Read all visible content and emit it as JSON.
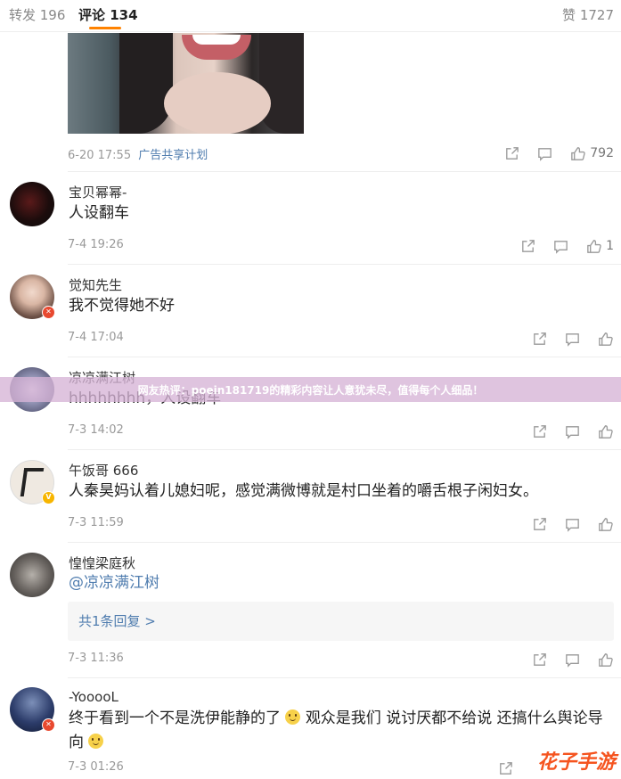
{
  "tabs": {
    "repost": "转发 196",
    "comment": "评论 134",
    "like": "赞 1727"
  },
  "top_post": {
    "time": "6-20 17:55",
    "ad_label": "广告共享计划",
    "like_count": "792"
  },
  "comments": [
    {
      "user": "宝贝幂幂-",
      "text": "人设翻车",
      "time": "7-4 19:26",
      "like_count": "1"
    },
    {
      "user": "觉知先生",
      "text": "我不觉得她不好",
      "time": "7-4 17:04",
      "like_count": ""
    },
    {
      "user": "凉凉满江树",
      "text": "hhhhhhhh，人设翻车",
      "time": "7-3 14:02",
      "like_count": ""
    },
    {
      "user": "午饭哥 666",
      "text": "人秦昊妈认着儿媳妇呢，感觉满微博就是村口坐着的嚼舌根子闲妇女。",
      "time": "7-3 11:59",
      "like_count": ""
    },
    {
      "user": "惶惶梁庭秋",
      "text": "@凉凉满江树",
      "time": "7-3 11:36",
      "like_count": "",
      "replies": "共1条回复 >"
    },
    {
      "user": "-YooooL",
      "text": "终于看到一个不是洗伊能静的了",
      "text_cont": "观众是我们 说讨厌都不给说 还搞什么舆论导向",
      "time": "7-3 01:26",
      "like_count": ""
    }
  ],
  "avatar_badges": {
    "red": "✕",
    "gold": "V"
  },
  "banner": "网友热评：poein181719的精彩内容让人意犹未尽，值得每个人细品！",
  "watermark": "花子手游",
  "icons": [
    "share-icon",
    "comment-icon",
    "like-icon"
  ],
  "colors": {
    "accent": "#ff8200",
    "link": "#507daf",
    "badge_red": "#e8492f",
    "badge_gold": "#f7b500"
  }
}
